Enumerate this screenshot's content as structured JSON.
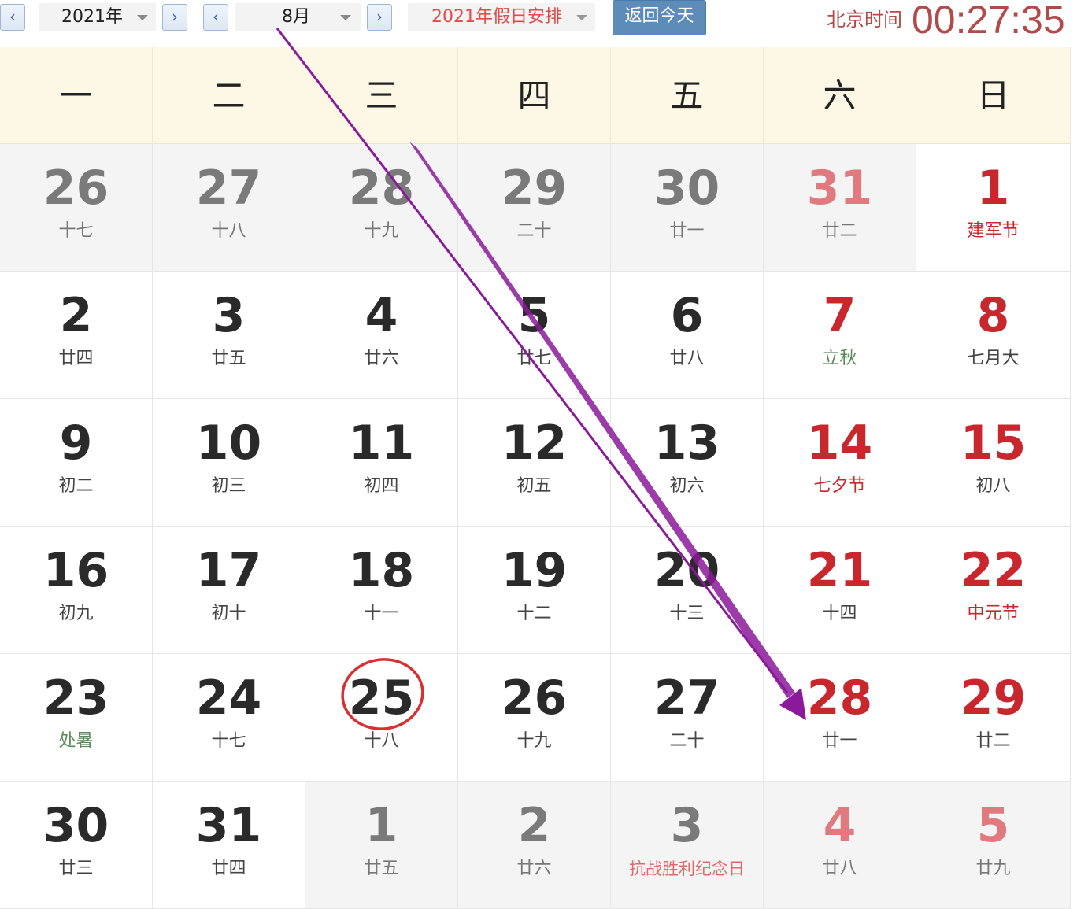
{
  "toolbar": {
    "prev_year": "‹",
    "year": "2021年",
    "next_year": "›",
    "prev_month": "‹",
    "month": "8月",
    "next_month": "›",
    "holiday_select": "2021年假日安排",
    "today_button": "返回今天",
    "clock_label": "北京时间",
    "clock_time": "00:27:35"
  },
  "weekdays": [
    "一",
    "二",
    "三",
    "四",
    "五",
    "六",
    "日"
  ],
  "weeks": [
    [
      {
        "day": "26",
        "lunar": "十七",
        "other": true
      },
      {
        "day": "27",
        "lunar": "十八",
        "other": true
      },
      {
        "day": "28",
        "lunar": "十九",
        "other": true
      },
      {
        "day": "29",
        "lunar": "二十",
        "other": true
      },
      {
        "day": "30",
        "lunar": "廿一",
        "other": true
      },
      {
        "day": "31",
        "lunar": "廿二",
        "other": true,
        "weekend": true
      },
      {
        "day": "1",
        "lunar": "建军节",
        "weekend": true,
        "festival": true
      }
    ],
    [
      {
        "day": "2",
        "lunar": "廿四"
      },
      {
        "day": "3",
        "lunar": "廿五"
      },
      {
        "day": "4",
        "lunar": "廿六"
      },
      {
        "day": "5",
        "lunar": "廿七"
      },
      {
        "day": "6",
        "lunar": "廿八"
      },
      {
        "day": "7",
        "lunar": "立秋",
        "weekend": true,
        "term": true
      },
      {
        "day": "8",
        "lunar": "七月大",
        "weekend": true
      }
    ],
    [
      {
        "day": "9",
        "lunar": "初二"
      },
      {
        "day": "10",
        "lunar": "初三"
      },
      {
        "day": "11",
        "lunar": "初四"
      },
      {
        "day": "12",
        "lunar": "初五"
      },
      {
        "day": "13",
        "lunar": "初六"
      },
      {
        "day": "14",
        "lunar": "七夕节",
        "weekend": true,
        "festival": true
      },
      {
        "day": "15",
        "lunar": "初八",
        "weekend": true
      }
    ],
    [
      {
        "day": "16",
        "lunar": "初九"
      },
      {
        "day": "17",
        "lunar": "初十"
      },
      {
        "day": "18",
        "lunar": "十一"
      },
      {
        "day": "19",
        "lunar": "十二"
      },
      {
        "day": "20",
        "lunar": "十三"
      },
      {
        "day": "21",
        "lunar": "十四",
        "weekend": true
      },
      {
        "day": "22",
        "lunar": "中元节",
        "weekend": true,
        "festival": true
      }
    ],
    [
      {
        "day": "23",
        "lunar": "处暑",
        "term": true
      },
      {
        "day": "24",
        "lunar": "十七"
      },
      {
        "day": "25",
        "lunar": "十八",
        "circled": true
      },
      {
        "day": "26",
        "lunar": "十九"
      },
      {
        "day": "27",
        "lunar": "二十"
      },
      {
        "day": "28",
        "lunar": "廿一",
        "weekend": true
      },
      {
        "day": "29",
        "lunar": "廿二",
        "weekend": true
      }
    ],
    [
      {
        "day": "30",
        "lunar": "廿三"
      },
      {
        "day": "31",
        "lunar": "廿四"
      },
      {
        "day": "1",
        "lunar": "廿五",
        "other": true
      },
      {
        "day": "2",
        "lunar": "廿六",
        "other": true
      },
      {
        "day": "3",
        "lunar": "抗战胜利纪念日",
        "other": true,
        "festival": true
      },
      {
        "day": "4",
        "lunar": "廿八",
        "other": true,
        "weekend": true
      },
      {
        "day": "5",
        "lunar": "廿九",
        "other": true,
        "weekend": true
      }
    ]
  ],
  "colors": {
    "accent_red": "#c8272d",
    "header_bg": "#fdf8e6",
    "annotation_arrow": "#8a1a9a",
    "annotation_circle": "#d83030"
  }
}
